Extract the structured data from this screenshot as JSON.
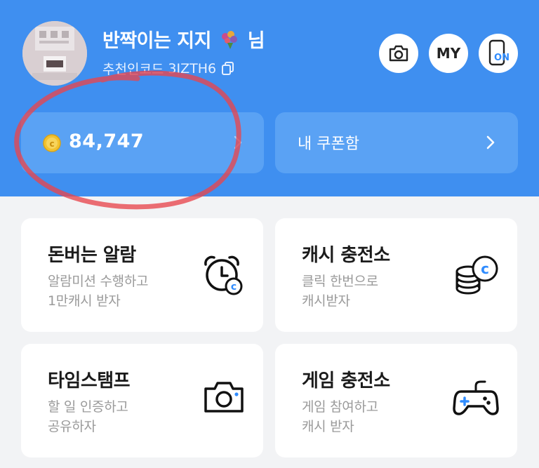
{
  "profile": {
    "username": "반짝이는 지지",
    "username_suffix": "님",
    "referral_label": "추천인코드",
    "referral_code": "3IZTH6",
    "avatar_icon": "profile-photo",
    "copy_icon": "copy-icon"
  },
  "header_actions": [
    {
      "icon": "camera-icon"
    },
    {
      "label": "MY"
    },
    {
      "label": "ON",
      "icon": "phone-screen-on-icon"
    }
  ],
  "cash": {
    "amount": "84,747",
    "icon": "coin-icon"
  },
  "coupon": {
    "label": "내 쿠폰함"
  },
  "tiles": [
    {
      "title": "돈버는 알람",
      "desc_line1": "알람미션 수행하고",
      "desc_line2": "1만캐시 받자",
      "icon": "alarm-clock-coin-icon"
    },
    {
      "title": "캐시 충전소",
      "desc_line1": "클릭 한번으로",
      "desc_line2": "캐시받자",
      "icon": "coin-stack-icon"
    },
    {
      "title": "타임스탬프",
      "desc_line1": "할 일 인증하고",
      "desc_line2": "공유하자",
      "icon": "camera-icon"
    },
    {
      "title": "게임 충전소",
      "desc_line1": "게임 참여하고",
      "desc_line2": "캐시 받자",
      "icon": "gamepad-icon"
    }
  ],
  "colors": {
    "header_blue": "#3f8ff0",
    "card_blue": "#5aa2f4",
    "accent_blue": "#2f8cff",
    "coin_yellow": "#f2c230",
    "annotation_red": "#e8454d"
  }
}
